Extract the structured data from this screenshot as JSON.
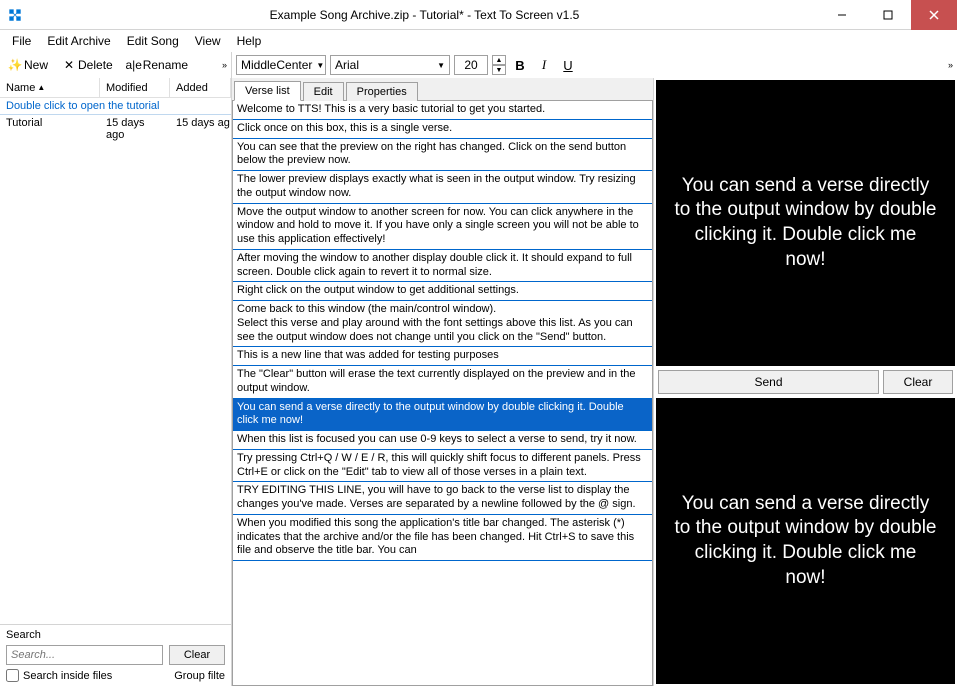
{
  "window": {
    "title": "Example Song Archive.zip - Tutorial* - Text To Screen v1.5"
  },
  "menu": {
    "file": "File",
    "edit_archive": "Edit Archive",
    "edit_song": "Edit Song",
    "view": "View",
    "help": "Help"
  },
  "left_toolbar": {
    "new": "New",
    "delete": "Delete",
    "rename": "Rename"
  },
  "mid_toolbar": {
    "align": "MiddleCenter",
    "font": "Arial",
    "size": "20",
    "bold": "B",
    "italic": "I",
    "underline": "U"
  },
  "columns": {
    "name": "Name",
    "modified": "Modified",
    "added": "Added"
  },
  "tutorial_link": "Double click to open the tutorial",
  "rows": [
    {
      "name": "Tutorial",
      "modified": "15 days ago",
      "added": "15 days ag"
    }
  ],
  "search": {
    "header": "Search",
    "placeholder": "Search...",
    "clear": "Clear",
    "inside": "Search inside files",
    "group": "Group filte"
  },
  "tabs": {
    "verse_list": "Verse list",
    "edit": "Edit",
    "properties": "Properties"
  },
  "verses": [
    "Welcome to TTS! This is a very basic tutorial to get you started.",
    "Click once on this box, this is a single verse.",
    "You can see that the preview on the right has changed. Click on the send button below the preview now.",
    "The lower preview displays exactly what is seen in the output window. Try resizing the output window now.",
    "Move the output window to another screen for now. You can click anywhere in the window and hold to move it. If you have only a single screen you will not be able to use this application effectively!",
    "After moving the window to another display double click it. It should expand to full screen. Double click again to revert it to normal size.",
    "Right click on the output window to get additional settings.",
    "Come back to this window (the main/control window).\nSelect this verse and play around with the font settings above this list. As you can see the output window does not change until you click on the \"Send\" button.",
    "This is a new line that was added for testing purposes",
    "The \"Clear\" button will erase the text currently displayed on the preview and in the output window.",
    "You can send a verse directly to the output window by double clicking it. Double click me now!",
    "When this list is focused you can use 0-9 keys to select a verse to send, try it now.",
    "Try pressing Ctrl+Q / W / E / R, this will quickly shift focus to different panels. Press Ctrl+E or click on the \"Edit\" tab to view all of those verses in a plain text.",
    "TRY EDITING THIS LINE, you will have to go back to the verse list to display the changes you've made. Verses are separated by a newline followed by the @ sign.",
    "When you modified this song the application's title bar changed. The asterisk (*) indicates that the archive and/or the file has been changed. Hit Ctrl+S to save this file and observe the title bar. You can"
  ],
  "selected_verse_index": 10,
  "preview_text": "You can send a verse directly to the output window by double clicking it. Double click me now!",
  "preview_buttons": {
    "send": "Send",
    "clear": "Clear"
  }
}
